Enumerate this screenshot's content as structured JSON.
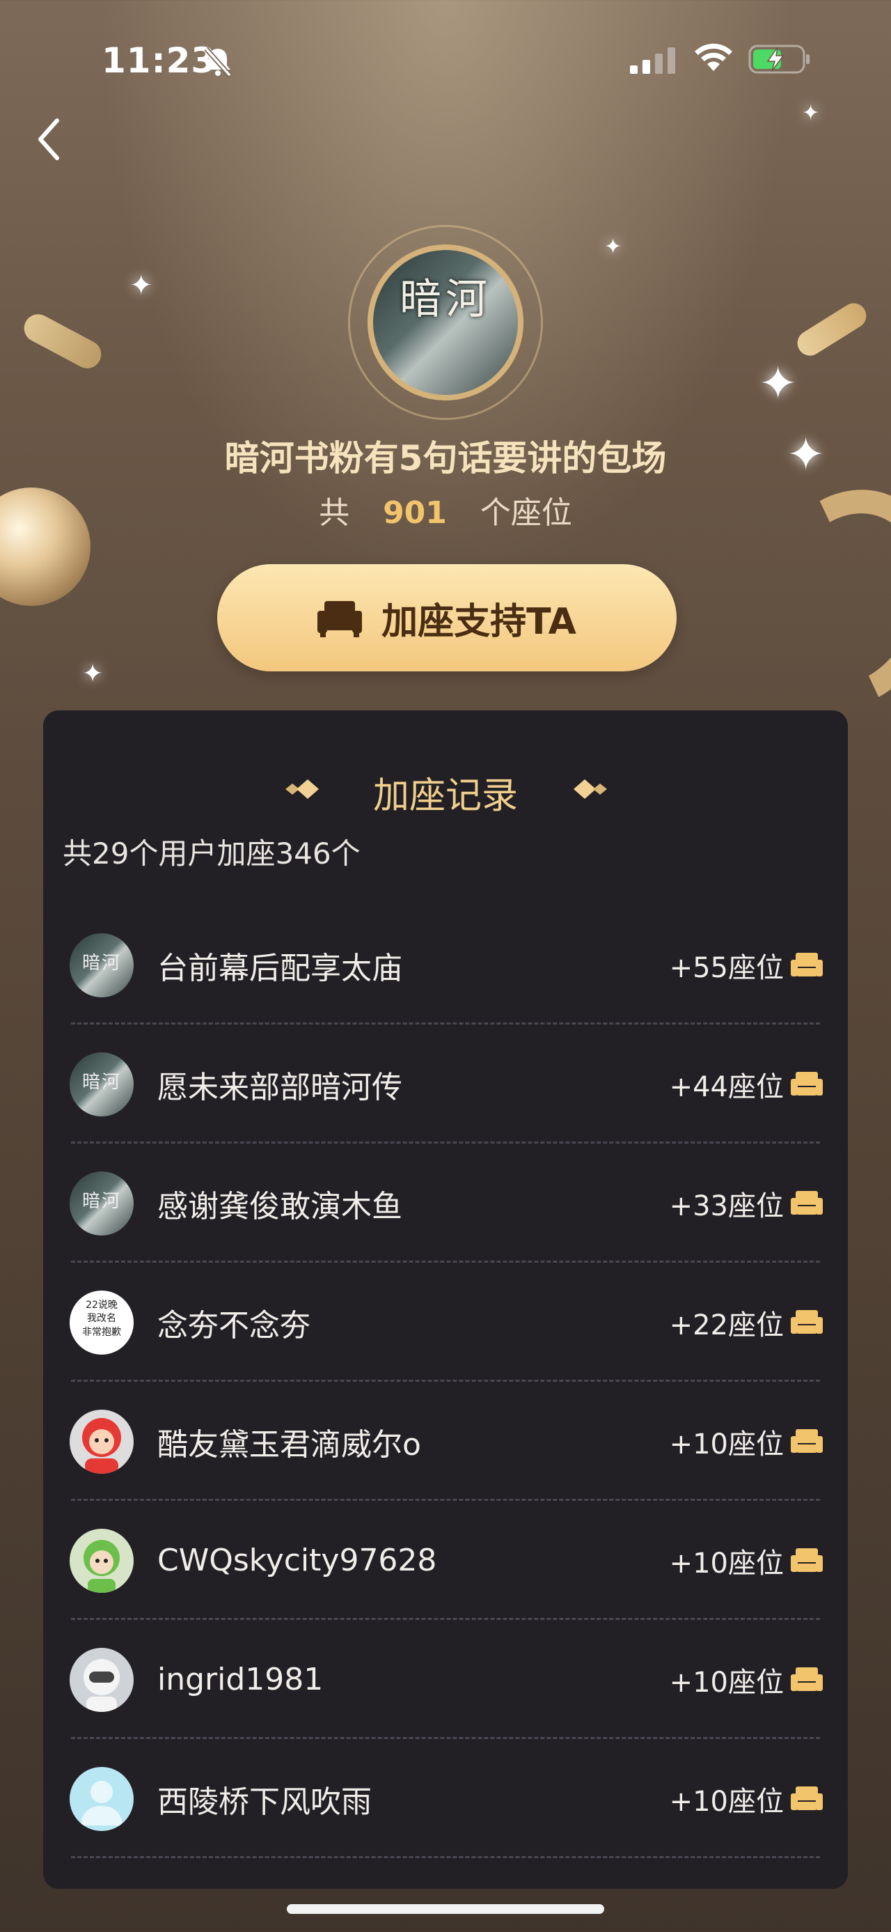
{
  "status_bar": {
    "time": "11:23"
  },
  "header": {
    "cover_text": "暗河",
    "title": "暗河书粉有5句话要讲的包场",
    "seat_prefix": "共",
    "seat_total": "901",
    "seat_suffix": "个座位",
    "support_button": "加座支持TA"
  },
  "records": {
    "title": "加座记录",
    "summary": "共29个用户加座346个",
    "items": [
      {
        "name": "台前幕后配享太庙",
        "seats": "+55座位",
        "avatar": "cover"
      },
      {
        "name": "愿未来部部暗河传",
        "seats": "+44座位",
        "avatar": "cover"
      },
      {
        "name": "感谢龚俊敢演木鱼",
        "seats": "+33座位",
        "avatar": "cover"
      },
      {
        "name": "念夯不念夯",
        "seats": "+22座位",
        "avatar": "text",
        "avatar_text": [
          "22说晚",
          "我改名",
          "非常抱歉"
        ]
      },
      {
        "name": "酷友黛玉君滴威尔o",
        "seats": "+10座位",
        "avatar": "red"
      },
      {
        "name": "CWQskycity97628",
        "seats": "+10座位",
        "avatar": "green"
      },
      {
        "name": "ingrid1981",
        "seats": "+10座位",
        "avatar": "white"
      },
      {
        "name": "西陵桥下风吹雨",
        "seats": "+10座位",
        "avatar": "blue"
      }
    ]
  },
  "colors": {
    "accent_gold": "#f2c46c",
    "panel_bg": "#222025",
    "button_gold": "#f3c77e"
  }
}
